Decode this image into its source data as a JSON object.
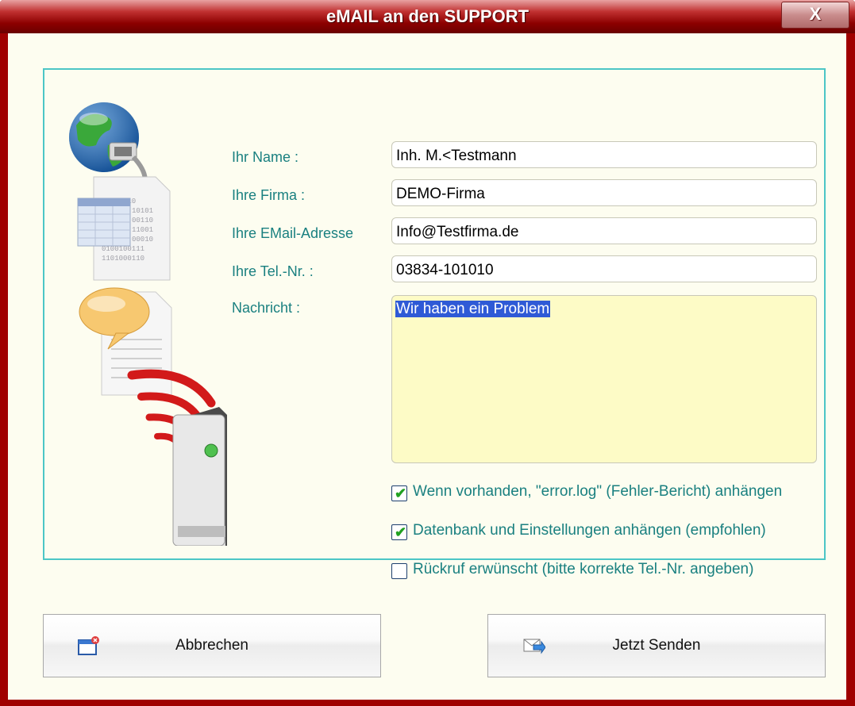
{
  "window": {
    "title": "eMAIL an den SUPPORT",
    "close_label": "X"
  },
  "form": {
    "name_label": "Ihr Name :",
    "name_value": "Inh. M.<Testmann",
    "company_label": "Ihre Firma :",
    "company_value": "DEMO-Firma",
    "email_label": "Ihre EMail-Adresse",
    "email_value": "Info@Testfirma.de",
    "phone_label": "Ihre Tel.-Nr. :",
    "phone_value": "03834-101010",
    "message_label": "Nachricht :",
    "message_value": "Wir haben ein Problem"
  },
  "illustration": {
    "binary_text": [
      "10011010",
      "10101",
      "00110",
      "11001",
      "00010",
      "0100100111",
      "1101000110"
    ]
  },
  "options": [
    {
      "label": "Wenn vorhanden, \"error.log\" (Fehler-Bericht) anhängen",
      "checked": true
    },
    {
      "label": "Datenbank und Einstellungen anhängen (empfohlen)",
      "checked": true
    },
    {
      "label": "Rückruf erwünscht (bitte korrekte Tel.-Nr. angeben)",
      "checked": false
    }
  ],
  "buttons": {
    "cancel_label": "Abbrechen",
    "send_label": "Jetzt Senden"
  },
  "colors": {
    "title_bar": "#8c0000",
    "label_text": "#1a8080",
    "panel_border": "#4cc6c6",
    "message_bg": "#fdfbc6",
    "check": "#21a121"
  }
}
